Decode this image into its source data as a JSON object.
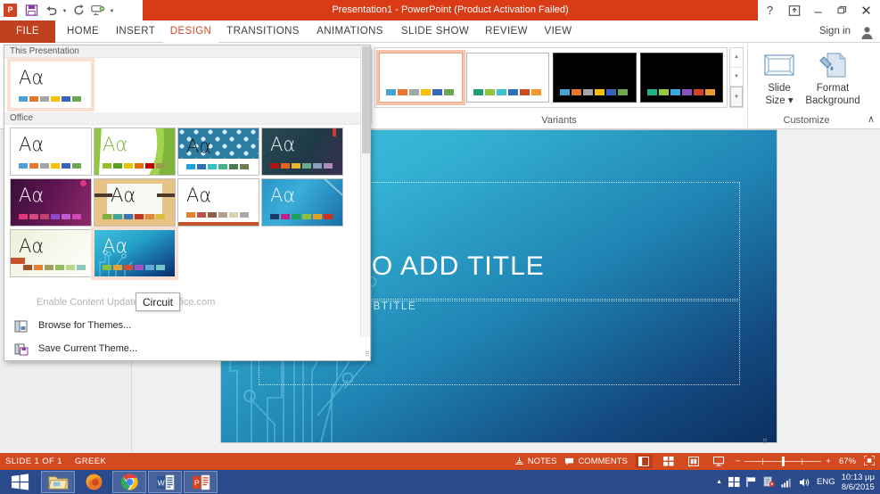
{
  "titlebar": {
    "app_icon": "powerpoint-icon",
    "title": "Presentation1 -  PowerPoint (Product Activation Failed)",
    "quick_access": [
      {
        "name": "save-icon",
        "label": "Save"
      },
      {
        "name": "undo-icon",
        "label": "Undo"
      },
      {
        "name": "redo-icon",
        "label": "Repeat"
      },
      {
        "name": "start-slideshow-icon",
        "label": "Start From Beginning"
      },
      {
        "name": "customize-qat-icon",
        "label": "Customize Quick Access Toolbar"
      }
    ],
    "window_controls": {
      "help": "?",
      "ribbon_display": "⤒",
      "minimize": "–",
      "restore": "❐",
      "close": "✕"
    }
  },
  "tabs": [
    {
      "label": "FILE",
      "name": "tab-file"
    },
    {
      "label": "HOME",
      "name": "tab-home"
    },
    {
      "label": "INSERT",
      "name": "tab-insert"
    },
    {
      "label": "DESIGN",
      "name": "tab-design"
    },
    {
      "label": "TRANSITIONS",
      "name": "tab-transitions"
    },
    {
      "label": "ANIMATIONS",
      "name": "tab-animations"
    },
    {
      "label": "SLIDE SHOW",
      "name": "tab-slide-show"
    },
    {
      "label": "REVIEW",
      "name": "tab-review"
    },
    {
      "label": "VIEW",
      "name": "tab-view"
    }
  ],
  "account": {
    "sign_in": "Sign in",
    "avatar_icon": "person-icon"
  },
  "ribbon": {
    "variants": {
      "group_label": "Variants",
      "items": [
        {
          "name": "variant-1",
          "dark": false,
          "selected": true,
          "swatches": [
            "#4a9fd4",
            "#e8762c",
            "#a5a5a5",
            "#fcc000",
            "#3864b8",
            "#6aa74f"
          ]
        },
        {
          "name": "variant-2",
          "dark": false,
          "selected": false,
          "swatches": [
            "#1f9e6e",
            "#93c43d",
            "#3ec0d6",
            "#2f6fb5",
            "#d04a1c",
            "#f0992e"
          ]
        },
        {
          "name": "variant-3",
          "dark": true,
          "selected": false,
          "swatches": [
            "#4a9fd4",
            "#e8762c",
            "#a5a5a5",
            "#fcc000",
            "#3864b8",
            "#6aa74f"
          ]
        },
        {
          "name": "variant-4",
          "dark": true,
          "selected": false,
          "swatches": [
            "#20b28a",
            "#96c93d",
            "#39a8dc",
            "#8a52c0",
            "#d0402a",
            "#f0992e"
          ]
        }
      ],
      "scroll_up": "▲",
      "scroll_down": "▼",
      "more": "▼"
    },
    "customize": {
      "group_label": "Customize",
      "slide_size": {
        "label_top": "Slide",
        "label_bottom": "Size",
        "icon": "slide-size-icon",
        "caret": "▾"
      },
      "format_background": {
        "label_top": "Format",
        "label_bottom": "Background",
        "icon": "format-background-icon"
      },
      "collapse": "∧"
    }
  },
  "themes_dropdown": {
    "sections": [
      {
        "title": "This Presentation",
        "name": "section-this-presentation",
        "themes": [
          {
            "name": "theme-office-current",
            "style": "plain",
            "selected": true,
            "swatches": [
              "#4a9fd4",
              "#e8762c",
              "#a5a5a5",
              "#fcc000",
              "#3864b8",
              "#6aa74f"
            ]
          }
        ]
      },
      {
        "title": "Office",
        "name": "section-office",
        "themes": [
          {
            "name": "theme-office",
            "style": "plain",
            "selected": false,
            "swatches": [
              "#4a9fd4",
              "#e8762c",
              "#a5a5a5",
              "#fcc000",
              "#3864b8",
              "#6aa74f"
            ]
          },
          {
            "name": "theme-facet",
            "style": "facet",
            "selected": false,
            "swatches": [
              "#90c226",
              "#54a021",
              "#e8c400",
              "#e66c00",
              "#c00000",
              "#9b9b4d"
            ]
          },
          {
            "name": "theme-ion",
            "style": "ion",
            "selected": false,
            "swatches": [
              "#1ca5dc",
              "#2f6fb5",
              "#2fc4c4",
              "#45b08c",
              "#4a7a52",
              "#6d7d4e"
            ]
          },
          {
            "name": "theme-ion-boardroom",
            "style": "ionboard",
            "selected": false,
            "swatches": [
              "#b01513",
              "#ea6312",
              "#e6b729",
              "#6aac90",
              "#8c9ec0",
              "#b08cc0"
            ]
          },
          {
            "name": "theme-berlin",
            "style": "berlin",
            "selected": false,
            "swatches": [
              "#e3357e",
              "#d04a7c",
              "#c2406f",
              "#8a4ad0",
              "#c05ad0",
              "#d04ab5"
            ]
          },
          {
            "name": "theme-wisp",
            "style": "wisp",
            "selected": false,
            "swatches": [
              "#7fae42",
              "#3fa79a",
              "#3b76b8",
              "#c0392b",
              "#e0893a",
              "#d9c03a"
            ]
          },
          {
            "name": "theme-banded",
            "style": "banded",
            "selected": false,
            "swatches": [
              "#e87f2c",
              "#c0504d",
              "#8c6040",
              "#b0a08a",
              "#d8d0b0",
              "#a8a8a8"
            ]
          },
          {
            "name": "theme-celestial",
            "style": "celestial",
            "selected": false,
            "swatches": [
              "#1f3864",
              "#c02089",
              "#20a05a",
              "#8ec040",
              "#e8a020",
              "#d03020"
            ]
          },
          {
            "name": "theme-quotable",
            "style": "quotable",
            "selected": false,
            "swatches": [
              "#a0522d",
              "#e08030",
              "#a0a060",
              "#8fbc5a",
              "#b8d88a",
              "#8fc8b8"
            ]
          },
          {
            "name": "theme-circuit",
            "style": "circuit",
            "selected": true,
            "swatches": [
              "#8ac040",
              "#e8a030",
              "#d05030",
              "#a050c0",
              "#60a8d8",
              "#70c8c0"
            ]
          }
        ]
      }
    ],
    "footer": [
      {
        "label": "Enable Content Updates from Office.com",
        "name": "menu-enable-content-updates",
        "disabled": true,
        "icon": ""
      },
      {
        "label": "Browse for Themes...",
        "name": "menu-browse-for-themes",
        "disabled": false,
        "icon": "browse-themes-icon"
      },
      {
        "label": "Save Current Theme...",
        "name": "menu-save-current-theme",
        "disabled": false,
        "icon": "save-theme-icon"
      }
    ],
    "tooltip": "Circuit"
  },
  "slide": {
    "title_placeholder": "CLICK TO ADD TITLE",
    "subtitle_placeholder": "CLICK TO ADD SUBTITLE",
    "accent_color": "#1f84b4"
  },
  "statusbar": {
    "slide_counter": "SLIDE 1 OF 1",
    "language": "GREEK",
    "notes": "NOTES",
    "comments": "COMMENTS",
    "views": [
      {
        "name": "view-normal",
        "icon": "normal-view-icon",
        "active": true
      },
      {
        "name": "view-slide-sorter",
        "icon": "slide-sorter-icon",
        "active": false
      },
      {
        "name": "view-reading",
        "icon": "reading-view-icon",
        "active": false
      },
      {
        "name": "view-slideshow",
        "icon": "slideshow-view-icon",
        "active": false
      }
    ],
    "zoom_out": "−",
    "zoom_in": "+",
    "zoom_level": "67%",
    "fit_to_window": "fit-slide-icon"
  },
  "taskbar": {
    "start": "windows-start-icon",
    "items": [
      {
        "name": "taskbar-file-explorer",
        "icon": "folder-icon",
        "open": true
      },
      {
        "name": "taskbar-firefox",
        "icon": "firefox-icon",
        "open": false
      },
      {
        "name": "taskbar-chrome",
        "icon": "chrome-icon",
        "open": true
      },
      {
        "name": "taskbar-word",
        "icon": "word-icon",
        "open": true
      },
      {
        "name": "taskbar-powerpoint",
        "icon": "powerpoint-icon",
        "open": true
      }
    ],
    "tray": {
      "show_hidden": "▲",
      "icons": [
        "action-center-icon",
        "flag-icon",
        "antivirus-icon",
        "network-icon",
        "volume-icon"
      ],
      "language": "ENG",
      "time": "10:13 μμ",
      "date": "8/6/2015"
    }
  }
}
